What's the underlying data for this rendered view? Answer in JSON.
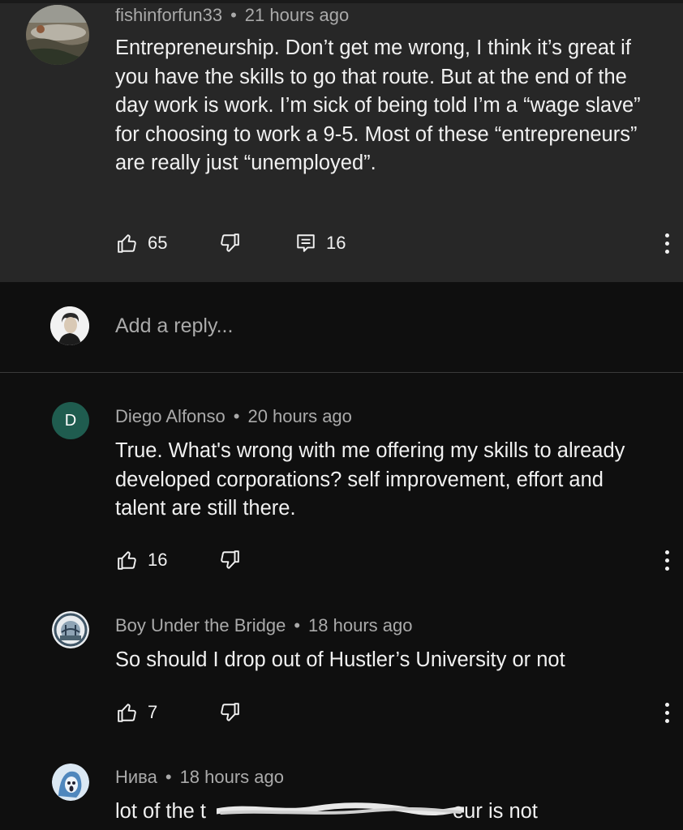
{
  "original_comment": {
    "author": "fishinforfun33",
    "time": "21 hours ago",
    "text": "Entrepreneurship. Don’t get me wrong, I think it’s great if you have the skills to go that route. But at the end of the day work is work. I’m sick of being told I’m a “wage slave” for choosing to work a 9-5. Most of these “entrepreneurs” are really just “unemployed”.",
    "likes": "65",
    "replies": "16",
    "avatar_icon": "landscape-avatar"
  },
  "reply_box": {
    "placeholder": "Add a reply..."
  },
  "replies": [
    {
      "author": "Diego Alfonso",
      "time": "20 hours ago",
      "avatar_letter": "D",
      "text": "True. What's wrong with me offering my skills to already developed corporations? self improvement, effort and talent are still there.",
      "likes": "16"
    },
    {
      "author": "Boy Under the Bridge",
      "time": "18 hours ago",
      "text": "So should I drop out of Hustler’s University or not",
      "likes": "7"
    },
    {
      "author": "Нива",
      "time": "18 hours ago",
      "text_start": "lot of the t",
      "text_end": "eur is not"
    }
  ],
  "colors": {
    "background": "#0f0f0f",
    "highlight": "#272727",
    "meta_text": "#aaaaaa",
    "avatar_green": "#1f5c4f"
  }
}
